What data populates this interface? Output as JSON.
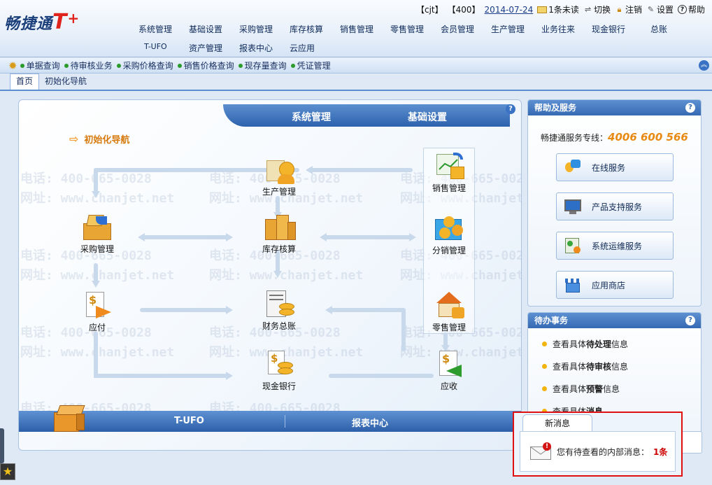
{
  "app": {
    "logo_text": "畅捷通",
    "logo_brand": "T",
    "logo_plus": "+"
  },
  "topbar": {
    "user": "【cjt】",
    "account": "【400】",
    "date": "2014-07-24",
    "unread": "1条未读",
    "switch": "切换",
    "logout": "注销",
    "settings": "设置",
    "help": "帮助"
  },
  "menu_row1": [
    "系统管理",
    "基础设置",
    "采购管理",
    "库存核算",
    "销售管理",
    "零售管理",
    "会员管理",
    "生产管理",
    "业务往来",
    "现金银行",
    "总账"
  ],
  "menu_row2": [
    "T-UFO",
    "资产管理",
    "报表中心",
    "云应用"
  ],
  "quickbar": [
    "单据查询",
    "待审核业务",
    "采购价格查询",
    "销售价格查询",
    "现存量查询",
    "凭证管理"
  ],
  "tabs": [
    "首页",
    "初始化导航"
  ],
  "main": {
    "header_left": "系统管理",
    "header_right": "基础设置",
    "nav_title": "初始化导航",
    "nodes": {
      "production": "生产管理",
      "sales": "销售管理",
      "purchase": "采购管理",
      "inventory": "库存核算",
      "distribution": "分销管理",
      "payable": "应付",
      "ledger": "财务总账",
      "retail": "零售管理",
      "cash": "现金银行",
      "receivable": "应收"
    },
    "bottom_left": "T-UFO",
    "bottom_right": "报表中心",
    "watermark_phone": "电话: 400-665-0028",
    "watermark_url": "网址: www.chanjet.net"
  },
  "help_panel": {
    "title": "帮助及服务",
    "hotline_label": "畅捷通服务专线：",
    "hotline_number": "4006 600 566",
    "services": [
      "在线服务",
      "产品支持服务",
      "系统运维服务",
      "应用商店"
    ]
  },
  "todo_panel": {
    "title": "待办事务",
    "items": [
      {
        "pre": "查看具体",
        "bold": "待处理",
        "post": "信息"
      },
      {
        "pre": "查看具体",
        "bold": "待审核",
        "post": "信息"
      },
      {
        "pre": "查看具体",
        "bold": "预警",
        "post": "信息"
      },
      {
        "pre": "查看具体",
        "bold": "消息",
        "post": ""
      }
    ]
  },
  "popup": {
    "tab": "新消息",
    "message": "您有待查看的内部消息：",
    "count": "1条"
  },
  "colors": {
    "accent": "#2d62ad",
    "highlight": "#e01010",
    "hotline": "#e88a12",
    "nav_title": "#d77a0e"
  }
}
